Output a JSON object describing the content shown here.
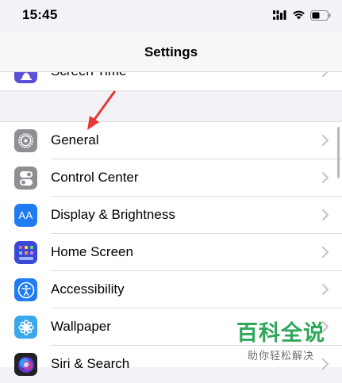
{
  "status_bar": {
    "time": "15:45"
  },
  "nav": {
    "title": "Settings"
  },
  "settings_rows": [
    {
      "label": "Screen Time",
      "icon": "hourglass-icon",
      "color": "#5b4fd6"
    },
    {
      "label": "General",
      "icon": "gear-icon",
      "color": "#8e8e93"
    },
    {
      "label": "Control Center",
      "icon": "toggles-icon",
      "color": "#8e8e93"
    },
    {
      "label": "Display & Brightness",
      "icon": "text-size-icon",
      "color": "#1f7cf2"
    },
    {
      "label": "Home Screen",
      "icon": "app-grid-icon",
      "color": "#3a4ad8"
    },
    {
      "label": "Accessibility",
      "icon": "accessibility-icon",
      "color": "#1f7cf2"
    },
    {
      "label": "Wallpaper",
      "icon": "flower-icon",
      "color": "#3aa7e8"
    },
    {
      "label": "Siri & Search",
      "icon": "siri-icon",
      "color": "#222222"
    }
  ],
  "display_icon_text": "AA",
  "watermark": {
    "main": "百科全说",
    "sub": "助你轻松解决"
  },
  "annotation": {
    "icon": "red-arrow-icon",
    "color": "#e53935"
  }
}
